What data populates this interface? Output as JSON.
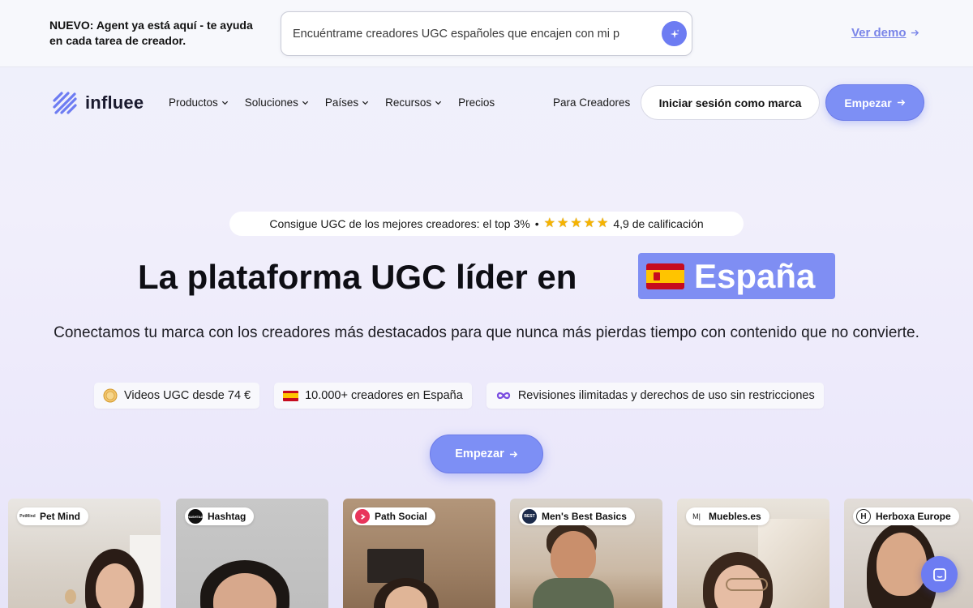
{
  "announcement": {
    "text": "NUEVO: Agent ya está aquí - te ayuda en cada tarea de creador.",
    "search_placeholder": "Encuéntrame creadores UGC españoles que encajen con mi p",
    "demo_link": "Ver demo"
  },
  "brand": {
    "name": "influee"
  },
  "nav": {
    "items": [
      {
        "label": "Productos",
        "has_dropdown": true
      },
      {
        "label": "Soluciones",
        "has_dropdown": true
      },
      {
        "label": "Países",
        "has_dropdown": true
      },
      {
        "label": "Recursos",
        "has_dropdown": true
      },
      {
        "label": "Precios",
        "has_dropdown": false
      }
    ],
    "for_creators": "Para Creadores",
    "login": "Iniciar sesión como marca",
    "start": "Empezar"
  },
  "hero": {
    "rating_text": "Consigue UGC de los mejores creadores: el top 3%",
    "rating_separator": "•",
    "rating_value": "4,9 de calificación",
    "stars": 5,
    "title": "La plataforma UGC líder en",
    "country": "España",
    "subtitle": "Conectamos tu marca con los creadores más destacados para que nunca más pierdas tiempo con contenido que no convierte.",
    "features": [
      {
        "icon": "coin-icon",
        "label": "Videos UGC desde 74 €"
      },
      {
        "icon": "spain-flag-icon",
        "label": "10.000+ creadores en España"
      },
      {
        "icon": "infinity-icon",
        "label": "Revisiones ilimitadas y derechos de uso sin restricciones"
      }
    ],
    "cta": "Empezar"
  },
  "cards": [
    {
      "brand": "Pet Mind",
      "logo_text": "PetMind"
    },
    {
      "brand": "Hashtag",
      "logo_text": "HASHTAG"
    },
    {
      "brand": "Path Social",
      "logo_text": ""
    },
    {
      "brand": "Men's Best Basics",
      "logo_text": "BEST"
    },
    {
      "brand": "Muebles.es",
      "logo_text": "M|"
    },
    {
      "brand": "Herboxa Europe",
      "logo_text": "H"
    }
  ],
  "colors": {
    "accent": "#7d8ff5",
    "accent_dark": "#6d7cf2",
    "link": "#7a85e8",
    "star": "#f5b301"
  }
}
